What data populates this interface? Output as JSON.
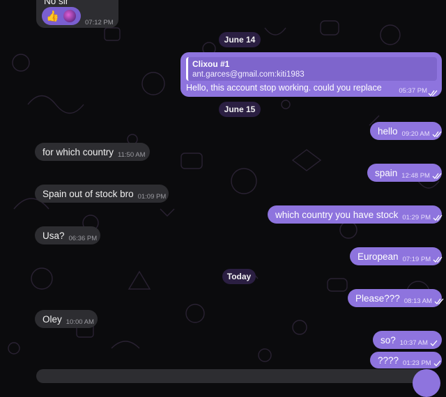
{
  "colors": {
    "background": "#0b0b0d",
    "incoming_bubble": "#2d2d31",
    "outgoing_bubble": "#8e74de",
    "date_pill": "#2b1f42"
  },
  "chat": {
    "top_partial": {
      "text": "No sir",
      "reactions": [
        "thumbs-up-icon",
        "avatar"
      ],
      "time": "07:12 PM"
    },
    "date_june14": "June 14",
    "reply_message": {
      "quote_title": "Clixou #1",
      "quote_text": "ant.garces@gmail.com:kiti1983",
      "text": "Hello, this account stop working. could you replace",
      "time": "05:37 PM"
    },
    "date_june15": "June 15",
    "date_today": "Today",
    "messages": [
      {
        "text": "hello",
        "time": "09:20 AM"
      },
      {
        "text": "for which country",
        "time": "11:50 AM"
      },
      {
        "text": "spain",
        "time": "12:48 PM"
      },
      {
        "text": "Spain out of stock bro",
        "time": "01:09 PM"
      },
      {
        "text": "which country you have stock",
        "time": "01:29 PM"
      },
      {
        "text": "Usa?",
        "time": "06:36 PM"
      },
      {
        "text": "European",
        "time": "07:19 PM"
      },
      {
        "text": "Please???",
        "time": "08:13 AM"
      },
      {
        "text": "Oley",
        "time": "10:00 AM"
      },
      {
        "text": "so?",
        "time": "10:37 AM"
      },
      {
        "text": "????",
        "time": "01:23 PM"
      }
    ]
  }
}
